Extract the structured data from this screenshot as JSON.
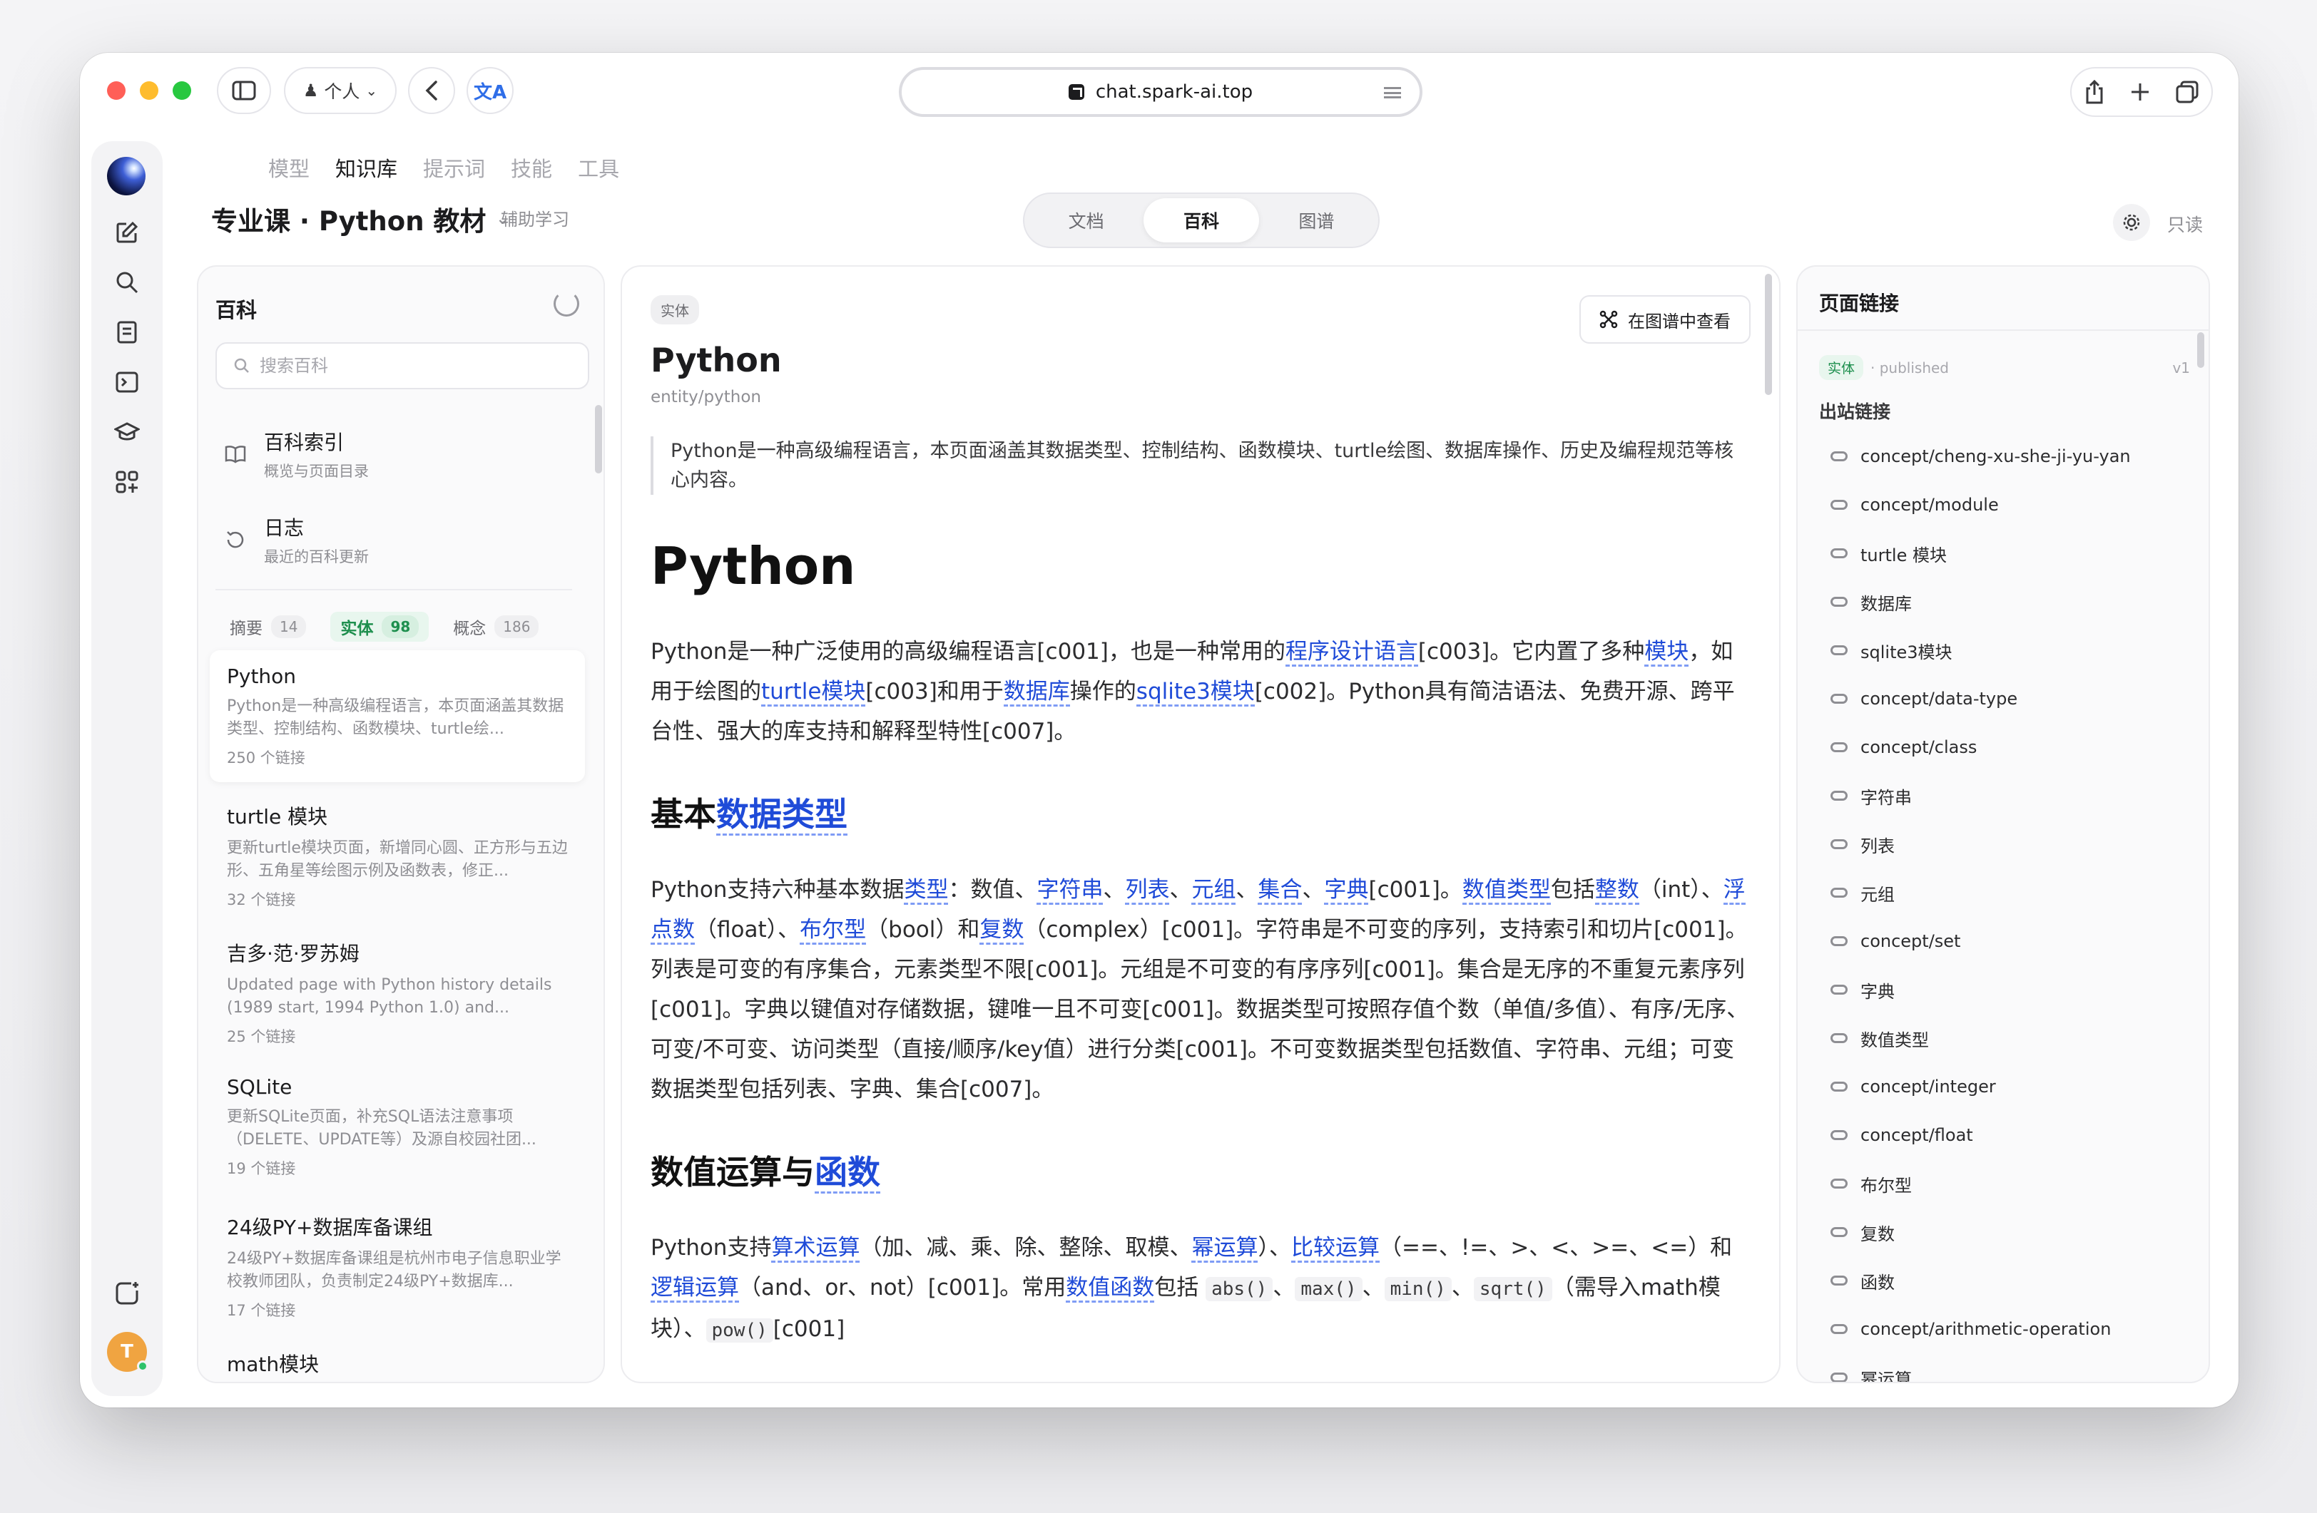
{
  "browser": {
    "profile_label": "个人",
    "url": "chat.spark-ai.top"
  },
  "topnav": [
    "模型",
    "知识库",
    "提示词",
    "技能",
    "工具"
  ],
  "topnav_active": 1,
  "header": {
    "title": "专业课 · Python 教材",
    "subtitle": "辅助学习",
    "tabs": [
      "文档",
      "百科",
      "图谱"
    ],
    "active_tab": 1,
    "mode": "只读"
  },
  "left": {
    "title": "百科",
    "search_placeholder": "搜索百科",
    "index": {
      "title": "百科索引",
      "subtitle": "概览与页面目录"
    },
    "log": {
      "title": "日志",
      "subtitle": "最近的百科更新"
    },
    "filters": [
      {
        "label": "摘要",
        "count": "14"
      },
      {
        "label": "实体",
        "count": "98"
      },
      {
        "label": "概念",
        "count": "186"
      }
    ],
    "cards": [
      {
        "title": "Python",
        "desc": "Python是一种高级编程语言，本页面涵盖其数据类型、控制结构、函数模块、turtle绘...",
        "meta": "250 个链接"
      },
      {
        "title": "turtle 模块",
        "desc": "更新turtle模块页面，新增同心圆、正方形与五边形、五角星等绘图示例及函数表，修正...",
        "meta": "32 个链接"
      },
      {
        "title": "吉多·范·罗苏姆",
        "desc": "Updated page with Python history details (1989 start, 1994 Python 1.0) and...",
        "meta": "25 个链接"
      },
      {
        "title": "SQLite",
        "desc": "更新SQLite页面，补充SQL语法注意事项（DELETE、UPDATE等）及源自校园社团...",
        "meta": "19 个链接"
      },
      {
        "title": "24级PY+数据库备课组",
        "desc": "24级PY+数据库备课组是杭州市电子信息职业学校教师团队，负责制定24级PY+数据库...",
        "meta": "17 个链接"
      },
      {
        "title": "math模块",
        "desc": "",
        "meta": ""
      }
    ]
  },
  "main": {
    "tag": "实体",
    "graph_button": "在图谱中查看",
    "title": "Python",
    "slug": "entity/python",
    "summary": "Python是一种高级编程语言，本页面涵盖其数据类型、控制结构、函数模块、turtle绘图、数据库操作、历史及编程规范等核心内容。",
    "h1": "Python",
    "p1": {
      "a": "Python是一种广泛使用的高级编程语言[c001]，也是一种常用的",
      "l1": "程序设计语言",
      "b": "[c003]。它内置了多种",
      "l2": "模块",
      "c": "，如用于绘图的",
      "l3": "turtle模块",
      "d": "[c003]和用于",
      "l4": "数据库",
      "e": "操作的",
      "l5": "sqlite3模块",
      "f": "[c002]。Python具有简洁语法、免费开源、跨平台性、强大的库支持和解释型特性[c007]。"
    },
    "h2a": {
      "prefix": "基本",
      "link": "数据类型"
    },
    "p2": {
      "a": "Python支持六种基本数据",
      "l1": "类型",
      "b": "：数值、",
      "l2": "字符串",
      "s1": "、",
      "l3": "列表",
      "s2": "、",
      "l4": "元组",
      "s3": "、",
      "l5": "集合",
      "s4": "、",
      "l6": "字典",
      "c": "[c001]。",
      "l7": "数值类型",
      "d": "包括",
      "l8": "整数",
      "e": "（int）、",
      "l9": "浮点数",
      "f": "（float）、",
      "l10": "布尔型",
      "g": "（bool）和",
      "l11": "复数",
      "h": "（complex）[c001]。字符串是不可变的序列，支持索引和切片[c001]。列表是可变的有序集合，元素类型不限[c001]。元组是不可变的有序序列[c001]。集合是无序的不重复元素序列[c001]。字典以键值对存储数据，键唯一且不可变[c001]。数据类型可按照存值个数（单值/多值）、有序/无序、可变/不可变、访问类型（直接/顺序/key值）进行分类[c001]。不可变数据类型包括数值、字符串、元组；可变数据类型包括列表、字典、集合[c007]。"
    },
    "h2b": {
      "prefix": "数值运算与",
      "link": "函数"
    },
    "p3": {
      "a": "Python支持",
      "l1": "算术运算",
      "b": "（加、减、乘、除、整除、取模、",
      "l2": "幂运算",
      "c": "）、",
      "l3": "比较运算",
      "d": "（==、!=、>、<、>=、<=）和",
      "l4": "逻辑运算",
      "e": "（and、or、not）[c001]。常用",
      "l5": "数值函数",
      "f": "包括 ",
      "code1": "abs()",
      "g": "、",
      "code2": "max()",
      "h": "、",
      "code3": "min()",
      "i": "、",
      "code4": "sqrt()",
      "j": "（需导入math模块）、",
      "code5": "pow()",
      "k": "[c001]"
    }
  },
  "right": {
    "title": "页面链接",
    "meta_tag": "实体",
    "meta_status": "· published",
    "meta_version": "v1",
    "section": "出站链接",
    "links": [
      "concept/cheng-xu-she-ji-yu-yan",
      "concept/module",
      "turtle 模块",
      "数据库",
      "sqlite3模块",
      "concept/data-type",
      "concept/class",
      "字符串",
      "列表",
      "元组",
      "concept/set",
      "字典",
      "数值类型",
      "concept/integer",
      "concept/float",
      "布尔型",
      "复数",
      "函数",
      "concept/arithmetic-operation",
      "幂运算"
    ]
  },
  "user": {
    "avatar_initial": "T"
  },
  "colors": {
    "link": "#1f4bd8",
    "accent_green": "#1e8f4e",
    "avatar": "#f0a441"
  }
}
